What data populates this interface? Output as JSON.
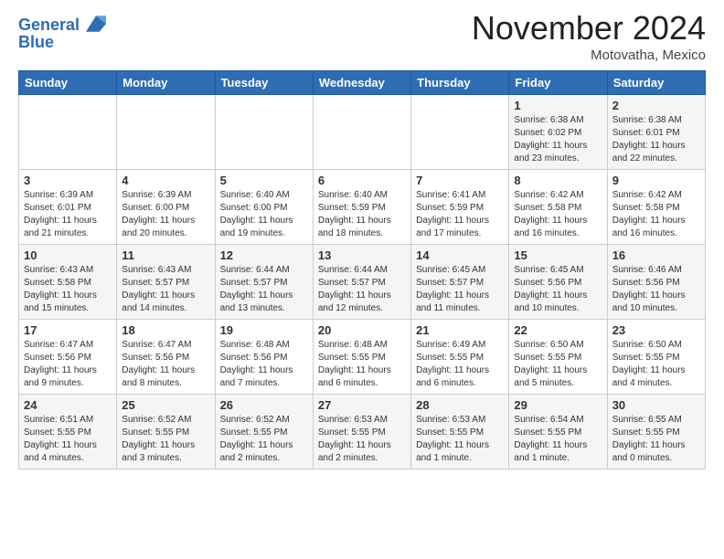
{
  "header": {
    "logo_line1": "General",
    "logo_line2": "Blue",
    "month_title": "November 2024",
    "location": "Motovatha, Mexico"
  },
  "weekdays": [
    "Sunday",
    "Monday",
    "Tuesday",
    "Wednesday",
    "Thursday",
    "Friday",
    "Saturday"
  ],
  "weeks": [
    [
      {
        "day": "",
        "info": ""
      },
      {
        "day": "",
        "info": ""
      },
      {
        "day": "",
        "info": ""
      },
      {
        "day": "",
        "info": ""
      },
      {
        "day": "",
        "info": ""
      },
      {
        "day": "1",
        "info": "Sunrise: 6:38 AM\nSunset: 6:02 PM\nDaylight: 11 hours and 23 minutes."
      },
      {
        "day": "2",
        "info": "Sunrise: 6:38 AM\nSunset: 6:01 PM\nDaylight: 11 hours and 22 minutes."
      }
    ],
    [
      {
        "day": "3",
        "info": "Sunrise: 6:39 AM\nSunset: 6:01 PM\nDaylight: 11 hours and 21 minutes."
      },
      {
        "day": "4",
        "info": "Sunrise: 6:39 AM\nSunset: 6:00 PM\nDaylight: 11 hours and 20 minutes."
      },
      {
        "day": "5",
        "info": "Sunrise: 6:40 AM\nSunset: 6:00 PM\nDaylight: 11 hours and 19 minutes."
      },
      {
        "day": "6",
        "info": "Sunrise: 6:40 AM\nSunset: 5:59 PM\nDaylight: 11 hours and 18 minutes."
      },
      {
        "day": "7",
        "info": "Sunrise: 6:41 AM\nSunset: 5:59 PM\nDaylight: 11 hours and 17 minutes."
      },
      {
        "day": "8",
        "info": "Sunrise: 6:42 AM\nSunset: 5:58 PM\nDaylight: 11 hours and 16 minutes."
      },
      {
        "day": "9",
        "info": "Sunrise: 6:42 AM\nSunset: 5:58 PM\nDaylight: 11 hours and 16 minutes."
      }
    ],
    [
      {
        "day": "10",
        "info": "Sunrise: 6:43 AM\nSunset: 5:58 PM\nDaylight: 11 hours and 15 minutes."
      },
      {
        "day": "11",
        "info": "Sunrise: 6:43 AM\nSunset: 5:57 PM\nDaylight: 11 hours and 14 minutes."
      },
      {
        "day": "12",
        "info": "Sunrise: 6:44 AM\nSunset: 5:57 PM\nDaylight: 11 hours and 13 minutes."
      },
      {
        "day": "13",
        "info": "Sunrise: 6:44 AM\nSunset: 5:57 PM\nDaylight: 11 hours and 12 minutes."
      },
      {
        "day": "14",
        "info": "Sunrise: 6:45 AM\nSunset: 5:57 PM\nDaylight: 11 hours and 11 minutes."
      },
      {
        "day": "15",
        "info": "Sunrise: 6:45 AM\nSunset: 5:56 PM\nDaylight: 11 hours and 10 minutes."
      },
      {
        "day": "16",
        "info": "Sunrise: 6:46 AM\nSunset: 5:56 PM\nDaylight: 11 hours and 10 minutes."
      }
    ],
    [
      {
        "day": "17",
        "info": "Sunrise: 6:47 AM\nSunset: 5:56 PM\nDaylight: 11 hours and 9 minutes."
      },
      {
        "day": "18",
        "info": "Sunrise: 6:47 AM\nSunset: 5:56 PM\nDaylight: 11 hours and 8 minutes."
      },
      {
        "day": "19",
        "info": "Sunrise: 6:48 AM\nSunset: 5:56 PM\nDaylight: 11 hours and 7 minutes."
      },
      {
        "day": "20",
        "info": "Sunrise: 6:48 AM\nSunset: 5:55 PM\nDaylight: 11 hours and 6 minutes."
      },
      {
        "day": "21",
        "info": "Sunrise: 6:49 AM\nSunset: 5:55 PM\nDaylight: 11 hours and 6 minutes."
      },
      {
        "day": "22",
        "info": "Sunrise: 6:50 AM\nSunset: 5:55 PM\nDaylight: 11 hours and 5 minutes."
      },
      {
        "day": "23",
        "info": "Sunrise: 6:50 AM\nSunset: 5:55 PM\nDaylight: 11 hours and 4 minutes."
      }
    ],
    [
      {
        "day": "24",
        "info": "Sunrise: 6:51 AM\nSunset: 5:55 PM\nDaylight: 11 hours and 4 minutes."
      },
      {
        "day": "25",
        "info": "Sunrise: 6:52 AM\nSunset: 5:55 PM\nDaylight: 11 hours and 3 minutes."
      },
      {
        "day": "26",
        "info": "Sunrise: 6:52 AM\nSunset: 5:55 PM\nDaylight: 11 hours and 2 minutes."
      },
      {
        "day": "27",
        "info": "Sunrise: 6:53 AM\nSunset: 5:55 PM\nDaylight: 11 hours and 2 minutes."
      },
      {
        "day": "28",
        "info": "Sunrise: 6:53 AM\nSunset: 5:55 PM\nDaylight: 11 hours and 1 minute."
      },
      {
        "day": "29",
        "info": "Sunrise: 6:54 AM\nSunset: 5:55 PM\nDaylight: 11 hours and 1 minute."
      },
      {
        "day": "30",
        "info": "Sunrise: 6:55 AM\nSunset: 5:55 PM\nDaylight: 11 hours and 0 minutes."
      }
    ]
  ]
}
